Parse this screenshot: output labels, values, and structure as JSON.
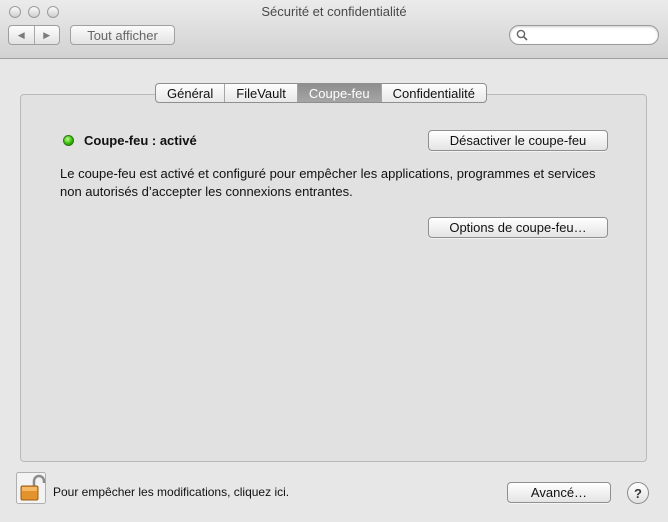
{
  "window": {
    "title": "Sécurité et confidentialité"
  },
  "toolbar": {
    "back_glyph": "◀",
    "forward_glyph": "▶",
    "show_all_label": "Tout afficher",
    "search": {
      "value": "",
      "placeholder": ""
    }
  },
  "tabs": [
    {
      "label": "Général",
      "selected": false
    },
    {
      "label": "FileVault",
      "selected": false
    },
    {
      "label": "Coupe-feu",
      "selected": true
    },
    {
      "label": "Confidentialité",
      "selected": false
    }
  ],
  "firewall": {
    "status_label": "Coupe-feu : activé",
    "status_color": "#2fb300",
    "toggle_button_label": "Désactiver le coupe-feu",
    "description": "Le coupe-feu est activé et configuré pour empêcher les applications, programmes et services non autorisés d’accepter les connexions entrantes.",
    "options_button_label": "Options de coupe-feu…"
  },
  "footer": {
    "lock_icon": "padlock-unlocked-icon",
    "lock_text": "Pour empêcher les modifications, cliquez ici.",
    "advanced_button_label": "Avancé…",
    "help_label": "?"
  }
}
